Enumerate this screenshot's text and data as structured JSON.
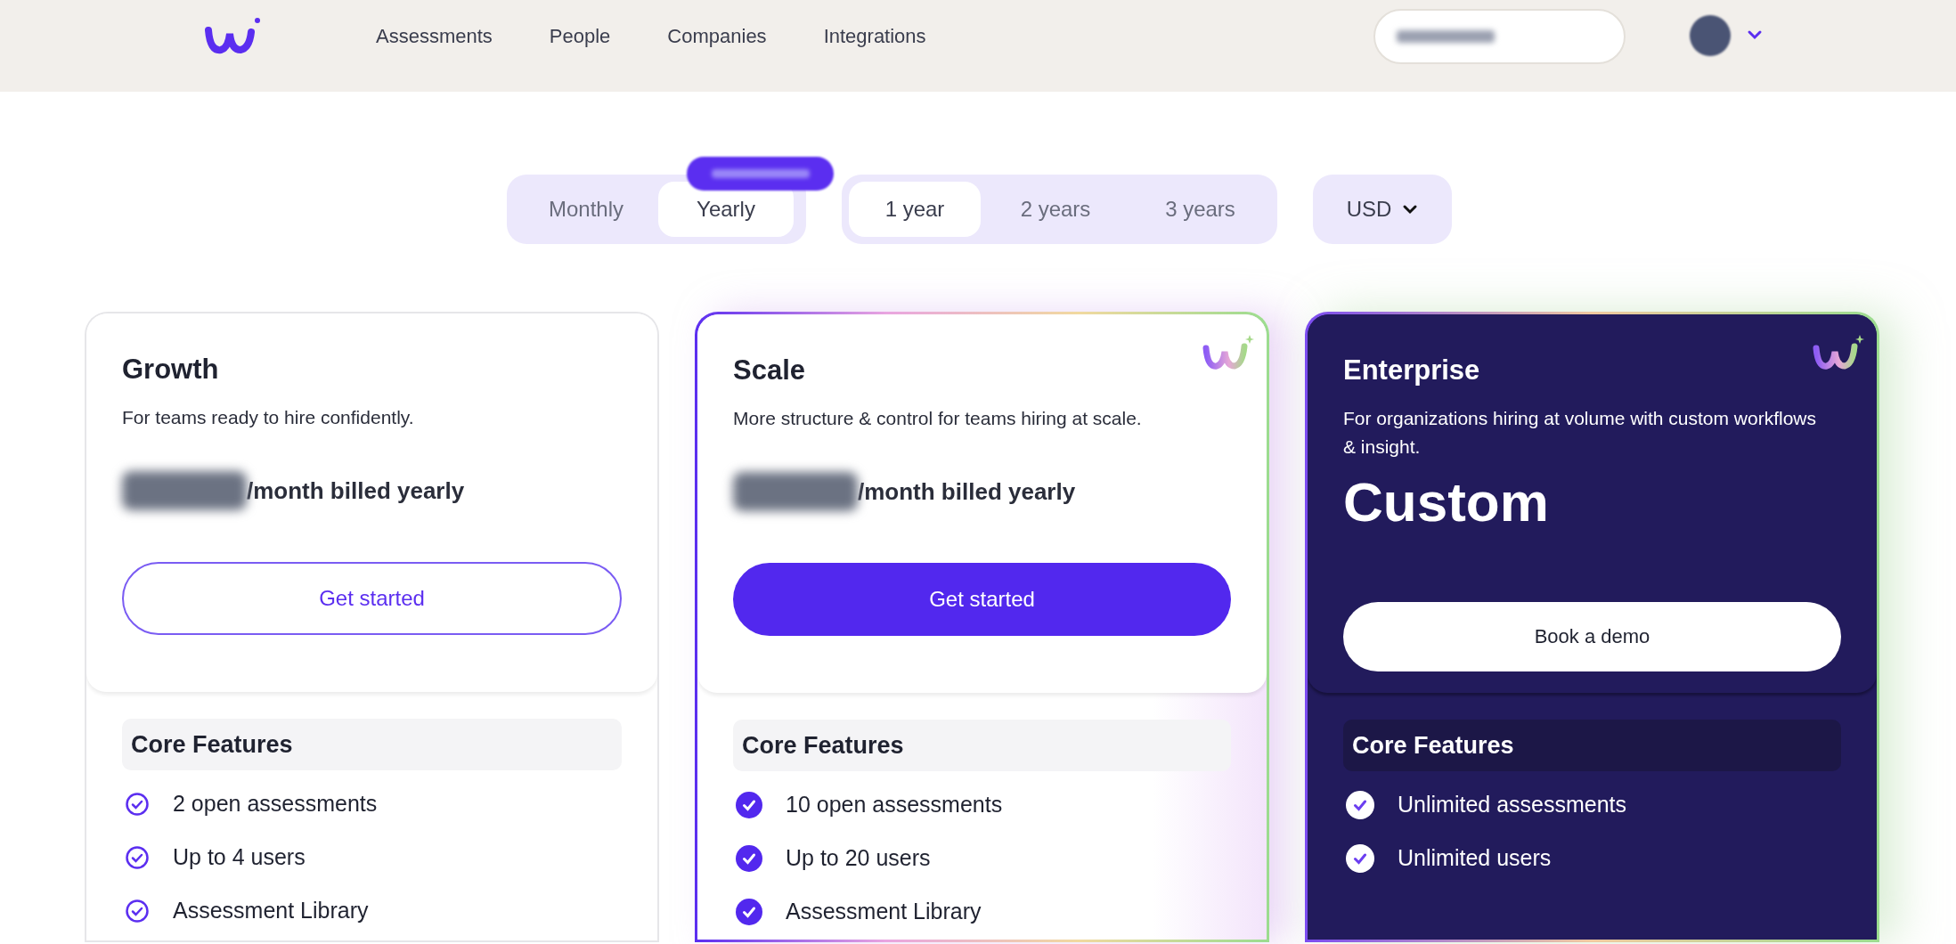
{
  "nav": {
    "links": [
      {
        "label": "Assessments"
      },
      {
        "label": "People"
      },
      {
        "label": "Companies"
      },
      {
        "label": "Integrations"
      }
    ]
  },
  "billing_period": [
    {
      "label": "Monthly",
      "selected": false
    },
    {
      "label": "Yearly",
      "selected": true
    }
  ],
  "term": [
    {
      "label": "1 year",
      "selected": true
    },
    {
      "label": "2 years",
      "selected": false
    },
    {
      "label": "3 years",
      "selected": false
    }
  ],
  "currency": {
    "value": "USD"
  },
  "plans": [
    {
      "name": "Growth",
      "kind": "light",
      "description": "For teams ready to hire confidently.",
      "price_suffix": "/month billed yearly",
      "button": {
        "label": "Get started",
        "kind": "outline"
      },
      "features_heading": "Core Features",
      "features": [
        "2 open assessments",
        "Up to 4 users",
        "Assessment Library"
      ]
    },
    {
      "name": "Scale",
      "kind": "featured",
      "description": "More structure & control for teams hiring at scale.",
      "price_suffix": "/month billed yearly",
      "button": {
        "label": "Get started",
        "kind": "filled"
      },
      "features_heading": "Core Features",
      "features": [
        "10 open assessments",
        "Up to 20 users",
        "Assessment Library"
      ]
    },
    {
      "name": "Enterprise",
      "kind": "dark",
      "description": "For organizations hiring at volume with custom workflows & insight.",
      "price": "Custom",
      "button": {
        "label": "Book a demo",
        "kind": "white"
      },
      "features_heading": "Core Features",
      "features": [
        "Unlimited assessments",
        "Unlimited users"
      ]
    }
  ]
}
